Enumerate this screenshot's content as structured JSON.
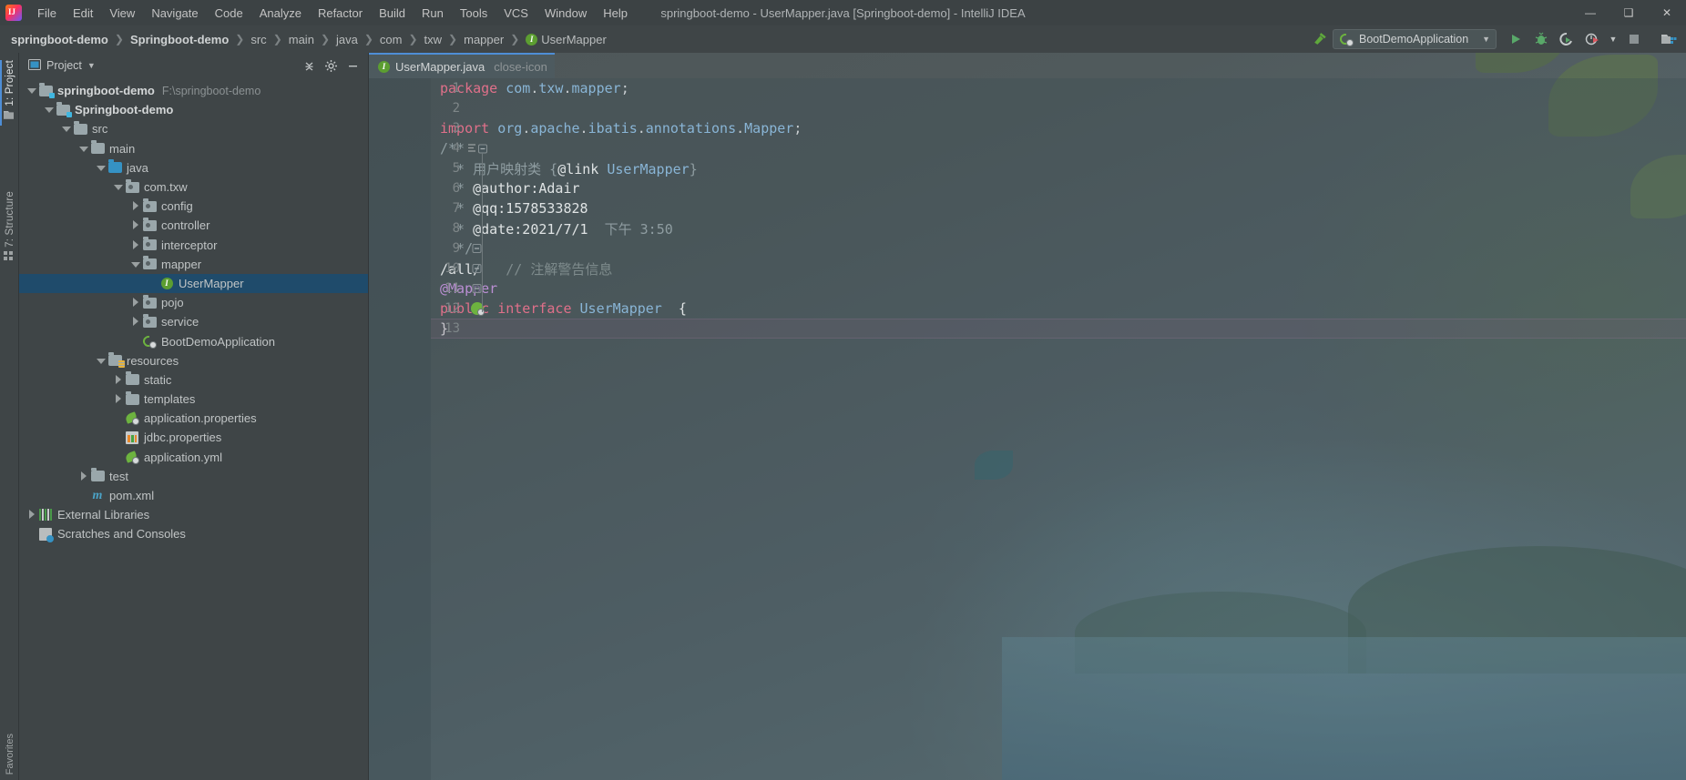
{
  "window": {
    "title": "springboot-demo - UserMapper.java [Springboot-demo] - IntelliJ IDEA",
    "minimize": "—",
    "maximize": "❑",
    "close": "✕"
  },
  "menu": [
    {
      "label": "File"
    },
    {
      "label": "Edit"
    },
    {
      "label": "View"
    },
    {
      "label": "Navigate"
    },
    {
      "label": "Code"
    },
    {
      "label": "Analyze"
    },
    {
      "label": "Refactor"
    },
    {
      "label": "Build"
    },
    {
      "label": "Run"
    },
    {
      "label": "Tools"
    },
    {
      "label": "VCS"
    },
    {
      "label": "Window"
    },
    {
      "label": "Help"
    }
  ],
  "breadcrumbs": [
    {
      "label": "springboot-demo",
      "bold": true
    },
    {
      "label": "Springboot-demo",
      "bold": true
    },
    {
      "label": "src"
    },
    {
      "label": "main"
    },
    {
      "label": "java"
    },
    {
      "label": "com"
    },
    {
      "label": "txw"
    },
    {
      "label": "mapper"
    },
    {
      "label": "UserMapper",
      "icon": "interface-icon"
    }
  ],
  "toolbar": {
    "build_icon": "hammer-icon",
    "run_config": "BootDemoApplication",
    "run_config_icon": "spring-boot-icon",
    "dropdown_icon": "chevron-down-icon",
    "buttons": [
      {
        "name": "run-button",
        "icon": "play-icon"
      },
      {
        "name": "debug-button",
        "icon": "bug-icon"
      },
      {
        "name": "run-with-coverage-button",
        "icon": "coverage-icon"
      },
      {
        "name": "profiler-button",
        "icon": "profiler-icon"
      },
      {
        "name": "profiler-dropdown",
        "icon": "chevron-down-icon"
      },
      {
        "name": "stop-button",
        "icon": "stop-icon"
      },
      {
        "name": "project-structure-button",
        "icon": "project-structure-icon"
      }
    ]
  },
  "toolwindows": [
    {
      "label": "1: Project",
      "icon": "project-icon",
      "active": true
    },
    {
      "label": "7: Structure",
      "icon": "structure-icon",
      "active": false
    }
  ],
  "favorites": {
    "label": "Favorites"
  },
  "project_panel": {
    "title": "Project",
    "dropdown_icon": "chevron-down-icon",
    "collapse_icon": "collapse-all-icon",
    "settings_icon": "gear-icon",
    "hide_icon": "minimize-icon",
    "tree": [
      {
        "label": "springboot-demo",
        "sublabel": "F:\\springboot-demo",
        "depth": 0,
        "arrow": "open",
        "icon": "module-folder-icon",
        "bold": true
      },
      {
        "label": "Springboot-demo",
        "sublabel": "",
        "depth": 1,
        "arrow": "open",
        "icon": "module-folder-icon",
        "bold": true
      },
      {
        "label": "src",
        "depth": 2,
        "arrow": "open",
        "icon": "folder-icon"
      },
      {
        "label": "main",
        "depth": 3,
        "arrow": "open",
        "icon": "folder-icon"
      },
      {
        "label": "java",
        "depth": 4,
        "arrow": "open",
        "icon": "source-folder-icon"
      },
      {
        "label": "com.txw",
        "depth": 5,
        "arrow": "open",
        "icon": "package-icon"
      },
      {
        "label": "config",
        "depth": 6,
        "arrow": "closed",
        "icon": "package-icon"
      },
      {
        "label": "controller",
        "depth": 6,
        "arrow": "closed",
        "icon": "package-icon"
      },
      {
        "label": "interceptor",
        "depth": 6,
        "arrow": "closed",
        "icon": "package-icon"
      },
      {
        "label": "mapper",
        "depth": 6,
        "arrow": "open",
        "icon": "package-icon"
      },
      {
        "label": "UserMapper",
        "depth": 7,
        "arrow": "none",
        "icon": "interface-icon",
        "selected": true
      },
      {
        "label": "pojo",
        "depth": 6,
        "arrow": "closed",
        "icon": "package-icon"
      },
      {
        "label": "service",
        "depth": 6,
        "arrow": "closed",
        "icon": "package-icon"
      },
      {
        "label": "BootDemoApplication",
        "depth": 6,
        "arrow": "none",
        "icon": "spring-boot-icon"
      },
      {
        "label": "resources",
        "depth": 4,
        "arrow": "open",
        "icon": "resources-folder-icon"
      },
      {
        "label": "static",
        "depth": 5,
        "arrow": "closed",
        "icon": "folder-icon"
      },
      {
        "label": "templates",
        "depth": 5,
        "arrow": "closed",
        "icon": "folder-icon"
      },
      {
        "label": "application.properties",
        "depth": 5,
        "arrow": "none",
        "icon": "spring-file-icon"
      },
      {
        "label": "jdbc.properties",
        "depth": 5,
        "arrow": "none",
        "icon": "properties-file-icon"
      },
      {
        "label": "application.yml",
        "depth": 5,
        "arrow": "none",
        "icon": "spring-file-icon"
      },
      {
        "label": "test",
        "depth": 3,
        "arrow": "closed",
        "icon": "folder-icon"
      },
      {
        "label": "pom.xml",
        "depth": 3,
        "arrow": "none",
        "icon": "maven-icon"
      },
      {
        "label": "External Libraries",
        "depth": 0,
        "arrow": "closed",
        "icon": "libraries-icon"
      },
      {
        "label": "Scratches and Consoles",
        "depth": 0,
        "arrow": "none",
        "icon": "scratches-icon"
      }
    ]
  },
  "editor": {
    "tab": {
      "label": "UserMapper.java",
      "icon": "interface-icon",
      "close_icon": "close-icon"
    },
    "lines": [
      {
        "num": "1",
        "gutter": "",
        "html": "<span class='kw'>package</span> <span class='id'>com</span><span class='pl'>.</span><span class='id'>txw</span><span class='pl'>.</span><span class='id'>mapper</span><span class='pl'>;</span>"
      },
      {
        "num": "2",
        "gutter": "",
        "html": ""
      },
      {
        "num": "3",
        "gutter": "",
        "html": "<span class='kw'>import</span> <span class='id'>org</span><span class='pl'>.</span><span class='id'>apache</span><span class='pl'>.</span><span class='id'>ibatis</span><span class='pl'>.</span><span class='id'>annotations</span><span class='pl'>.</span><span class='id'>Mapper</span><span class='pl'>;</span>"
      },
      {
        "num": "4",
        "gutter": "doc-fold",
        "html": "<span class='doc'>/**</span>"
      },
      {
        "num": "5",
        "gutter": "",
        "html": "<span class='doc'>  * 用户映射类 {</span><span class='white'>@link</span> <span class='id'>UserMapper</span><span class='doc'>}</span>"
      },
      {
        "num": "6",
        "gutter": "",
        "html": "<span class='doc'>  * </span><span class='white'>@author:Adair</span>"
      },
      {
        "num": "7",
        "gutter": "",
        "html": "<span class='doc'>  * </span><span class='white'>@qq:1578533828</span>"
      },
      {
        "num": "8",
        "gutter": "",
        "html": "<span class='doc'>  * </span><span class='white'>@date:2021/7/1</span><span class='doc'>  下午 3:50</span>"
      },
      {
        "num": "9",
        "gutter": "fold-end",
        "html": "<span class='doc'>  */</span>"
      },
      {
        "num": "10",
        "gutter": "fold",
        "html": "<span class='white'>/all/</span>   <span class='cm'>// 注解警告信息</span>"
      },
      {
        "num": "11",
        "gutter": "fold",
        "html": "<span class='ann'>@Mapper</span>"
      },
      {
        "num": "12",
        "gutter": "run",
        "html": "<span class='kw'>public</span> <span class='kw'>interface</span> <span class='id'>UserMapper</span>  <span class='white'>{</span>"
      },
      {
        "num": "13",
        "gutter": "",
        "html": "<span class='white'>}</span>",
        "current": true
      }
    ]
  },
  "colors": {
    "accent": "#4e8ed6",
    "selection": "#1f4b6b",
    "keyword": "#e0708a",
    "identifier": "#89b5d6",
    "comment": "#7f8c8d",
    "annotation": "#bb8fd4",
    "spring_green": "#6db33f",
    "panel_bg": "#3f4547",
    "titlebar_bg": "#3c4244"
  }
}
